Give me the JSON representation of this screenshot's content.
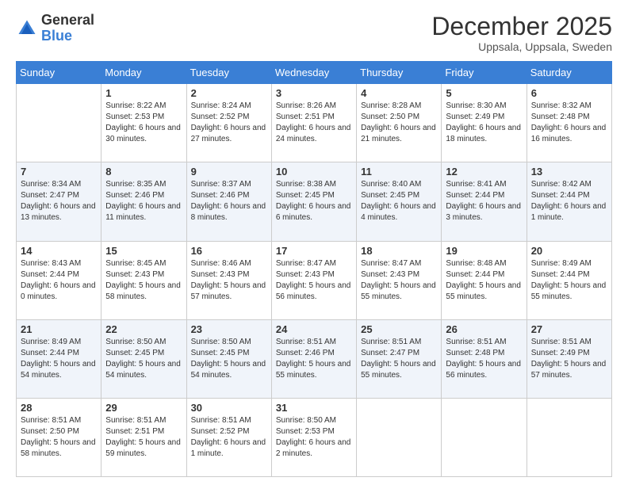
{
  "logo": {
    "general": "General",
    "blue": "Blue"
  },
  "title": "December 2025",
  "location": "Uppsala, Uppsala, Sweden",
  "days_of_week": [
    "Sunday",
    "Monday",
    "Tuesday",
    "Wednesday",
    "Thursday",
    "Friday",
    "Saturday"
  ],
  "weeks": [
    [
      {
        "day": "",
        "sunrise": "",
        "sunset": "",
        "daylight": ""
      },
      {
        "day": "1",
        "sunrise": "Sunrise: 8:22 AM",
        "sunset": "Sunset: 2:53 PM",
        "daylight": "Daylight: 6 hours and 30 minutes."
      },
      {
        "day": "2",
        "sunrise": "Sunrise: 8:24 AM",
        "sunset": "Sunset: 2:52 PM",
        "daylight": "Daylight: 6 hours and 27 minutes."
      },
      {
        "day": "3",
        "sunrise": "Sunrise: 8:26 AM",
        "sunset": "Sunset: 2:51 PM",
        "daylight": "Daylight: 6 hours and 24 minutes."
      },
      {
        "day": "4",
        "sunrise": "Sunrise: 8:28 AM",
        "sunset": "Sunset: 2:50 PM",
        "daylight": "Daylight: 6 hours and 21 minutes."
      },
      {
        "day": "5",
        "sunrise": "Sunrise: 8:30 AM",
        "sunset": "Sunset: 2:49 PM",
        "daylight": "Daylight: 6 hours and 18 minutes."
      },
      {
        "day": "6",
        "sunrise": "Sunrise: 8:32 AM",
        "sunset": "Sunset: 2:48 PM",
        "daylight": "Daylight: 6 hours and 16 minutes."
      }
    ],
    [
      {
        "day": "7",
        "sunrise": "Sunrise: 8:34 AM",
        "sunset": "Sunset: 2:47 PM",
        "daylight": "Daylight: 6 hours and 13 minutes."
      },
      {
        "day": "8",
        "sunrise": "Sunrise: 8:35 AM",
        "sunset": "Sunset: 2:46 PM",
        "daylight": "Daylight: 6 hours and 11 minutes."
      },
      {
        "day": "9",
        "sunrise": "Sunrise: 8:37 AM",
        "sunset": "Sunset: 2:46 PM",
        "daylight": "Daylight: 6 hours and 8 minutes."
      },
      {
        "day": "10",
        "sunrise": "Sunrise: 8:38 AM",
        "sunset": "Sunset: 2:45 PM",
        "daylight": "Daylight: 6 hours and 6 minutes."
      },
      {
        "day": "11",
        "sunrise": "Sunrise: 8:40 AM",
        "sunset": "Sunset: 2:45 PM",
        "daylight": "Daylight: 6 hours and 4 minutes."
      },
      {
        "day": "12",
        "sunrise": "Sunrise: 8:41 AM",
        "sunset": "Sunset: 2:44 PM",
        "daylight": "Daylight: 6 hours and 3 minutes."
      },
      {
        "day": "13",
        "sunrise": "Sunrise: 8:42 AM",
        "sunset": "Sunset: 2:44 PM",
        "daylight": "Daylight: 6 hours and 1 minute."
      }
    ],
    [
      {
        "day": "14",
        "sunrise": "Sunrise: 8:43 AM",
        "sunset": "Sunset: 2:44 PM",
        "daylight": "Daylight: 6 hours and 0 minutes."
      },
      {
        "day": "15",
        "sunrise": "Sunrise: 8:45 AM",
        "sunset": "Sunset: 2:43 PM",
        "daylight": "Daylight: 5 hours and 58 minutes."
      },
      {
        "day": "16",
        "sunrise": "Sunrise: 8:46 AM",
        "sunset": "Sunset: 2:43 PM",
        "daylight": "Daylight: 5 hours and 57 minutes."
      },
      {
        "day": "17",
        "sunrise": "Sunrise: 8:47 AM",
        "sunset": "Sunset: 2:43 PM",
        "daylight": "Daylight: 5 hours and 56 minutes."
      },
      {
        "day": "18",
        "sunrise": "Sunrise: 8:47 AM",
        "sunset": "Sunset: 2:43 PM",
        "daylight": "Daylight: 5 hours and 55 minutes."
      },
      {
        "day": "19",
        "sunrise": "Sunrise: 8:48 AM",
        "sunset": "Sunset: 2:44 PM",
        "daylight": "Daylight: 5 hours and 55 minutes."
      },
      {
        "day": "20",
        "sunrise": "Sunrise: 8:49 AM",
        "sunset": "Sunset: 2:44 PM",
        "daylight": "Daylight: 5 hours and 55 minutes."
      }
    ],
    [
      {
        "day": "21",
        "sunrise": "Sunrise: 8:49 AM",
        "sunset": "Sunset: 2:44 PM",
        "daylight": "Daylight: 5 hours and 54 minutes."
      },
      {
        "day": "22",
        "sunrise": "Sunrise: 8:50 AM",
        "sunset": "Sunset: 2:45 PM",
        "daylight": "Daylight: 5 hours and 54 minutes."
      },
      {
        "day": "23",
        "sunrise": "Sunrise: 8:50 AM",
        "sunset": "Sunset: 2:45 PM",
        "daylight": "Daylight: 5 hours and 54 minutes."
      },
      {
        "day": "24",
        "sunrise": "Sunrise: 8:51 AM",
        "sunset": "Sunset: 2:46 PM",
        "daylight": "Daylight: 5 hours and 55 minutes."
      },
      {
        "day": "25",
        "sunrise": "Sunrise: 8:51 AM",
        "sunset": "Sunset: 2:47 PM",
        "daylight": "Daylight: 5 hours and 55 minutes."
      },
      {
        "day": "26",
        "sunrise": "Sunrise: 8:51 AM",
        "sunset": "Sunset: 2:48 PM",
        "daylight": "Daylight: 5 hours and 56 minutes."
      },
      {
        "day": "27",
        "sunrise": "Sunrise: 8:51 AM",
        "sunset": "Sunset: 2:49 PM",
        "daylight": "Daylight: 5 hours and 57 minutes."
      }
    ],
    [
      {
        "day": "28",
        "sunrise": "Sunrise: 8:51 AM",
        "sunset": "Sunset: 2:50 PM",
        "daylight": "Daylight: 5 hours and 58 minutes."
      },
      {
        "day": "29",
        "sunrise": "Sunrise: 8:51 AM",
        "sunset": "Sunset: 2:51 PM",
        "daylight": "Daylight: 5 hours and 59 minutes."
      },
      {
        "day": "30",
        "sunrise": "Sunrise: 8:51 AM",
        "sunset": "Sunset: 2:52 PM",
        "daylight": "Daylight: 6 hours and 1 minute."
      },
      {
        "day": "31",
        "sunrise": "Sunrise: 8:50 AM",
        "sunset": "Sunset: 2:53 PM",
        "daylight": "Daylight: 6 hours and 2 minutes."
      },
      {
        "day": "",
        "sunrise": "",
        "sunset": "",
        "daylight": ""
      },
      {
        "day": "",
        "sunrise": "",
        "sunset": "",
        "daylight": ""
      },
      {
        "day": "",
        "sunrise": "",
        "sunset": "",
        "daylight": ""
      }
    ]
  ]
}
